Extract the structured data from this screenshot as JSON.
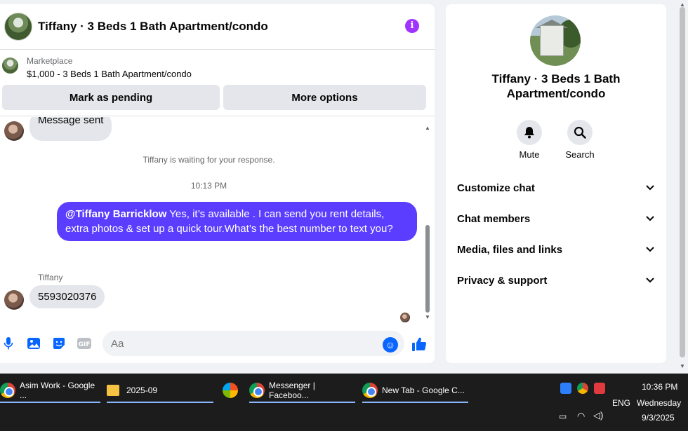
{
  "header": {
    "title": "Tiffany · 3 Beds 1 Bath Apartment/condo",
    "info_icon": "info-icon"
  },
  "marketplace": {
    "label": "Marketplace",
    "listing": "$1,000 - 3 Beds 1 Bath Apartment/condo",
    "pending_label": "Mark as pending",
    "more_label": "More options"
  },
  "messages": {
    "prev_incoming": "Message sent",
    "system_note": "Tiffany is waiting for your response.",
    "timestamp": "10:13 PM",
    "outgoing_mention": "@Tiffany Barricklow",
    "outgoing_text": " Yes, it’s available .  I can send you rent details, extra photos & set up a quick tour.What’s the best number to text you?",
    "sender_name": "Tiffany",
    "incoming_last": "5593020376"
  },
  "composer": {
    "placeholder": "Aa",
    "icons": [
      "microphone-icon",
      "image-icon",
      "sticker-icon",
      "gif-icon",
      "emoji-icon",
      "thumbs-up-icon"
    ]
  },
  "info_panel": {
    "name": "Tiffany · 3 Beds 1 Bath Apartment/condo",
    "mute_label": "Mute",
    "search_label": "Search",
    "sections": [
      "Customize chat",
      "Chat members",
      "Media, files and links",
      "Privacy & support"
    ]
  },
  "taskbar": {
    "tasks": [
      {
        "label": "Asim Work - Google ...",
        "icon": "chrome-icon"
      },
      {
        "label": "2025-09",
        "icon": "folder-icon"
      },
      {
        "label": "",
        "icon": "photos-app-icon"
      },
      {
        "label": "Messenger | Faceboo...",
        "icon": "chrome-icon"
      },
      {
        "label": "New Tab - Google C...",
        "icon": "chrome-icon"
      }
    ],
    "lang": "ENG",
    "time": "10:36 PM",
    "day": "Wednesday",
    "date": "9/3/2025"
  },
  "colors": {
    "accent": "#5b3dff",
    "messenger_blue": "#0866ff",
    "info_purple": "#a033ff",
    "taskbar": "#1c1c1c"
  }
}
